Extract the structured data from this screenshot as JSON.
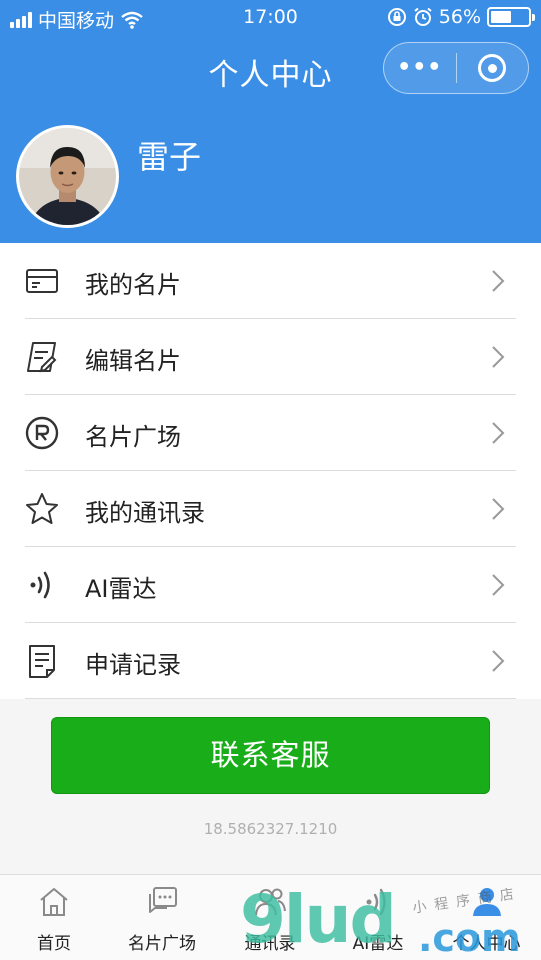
{
  "status_bar": {
    "carrier": "中国移动",
    "time": "17:00",
    "battery_percent": "56%",
    "battery_level": 0.56
  },
  "nav": {
    "title": "个人中心",
    "more_label": "•••"
  },
  "profile": {
    "name": "雷子"
  },
  "menu": {
    "items": [
      {
        "label": "我的名片",
        "icon": "card-icon"
      },
      {
        "label": "编辑名片",
        "icon": "edit-card-icon"
      },
      {
        "label": "名片广场",
        "icon": "square-icon"
      },
      {
        "label": "我的通讯录",
        "icon": "star-icon"
      },
      {
        "label": "AI雷达",
        "icon": "radar-icon"
      },
      {
        "label": "申请记录",
        "icon": "document-icon"
      }
    ]
  },
  "contact_button": {
    "label": "联系客服"
  },
  "version": "18.5862327.1210",
  "tabbar": {
    "items": [
      {
        "label": "首页",
        "icon": "home-icon"
      },
      {
        "label": "名片广场",
        "icon": "chat-icon"
      },
      {
        "label": "通讯录",
        "icon": "contacts-icon"
      },
      {
        "label": "AI雷达",
        "icon": "radar-icon"
      },
      {
        "label": "个人中心",
        "icon": "person-icon",
        "active": true
      }
    ]
  },
  "watermark": {
    "brand": "9lud",
    "domain": ".com",
    "handwritten": "小程序商店"
  },
  "colors": {
    "header_blue": "#3a8ee6",
    "button_green": "#19ad19"
  }
}
